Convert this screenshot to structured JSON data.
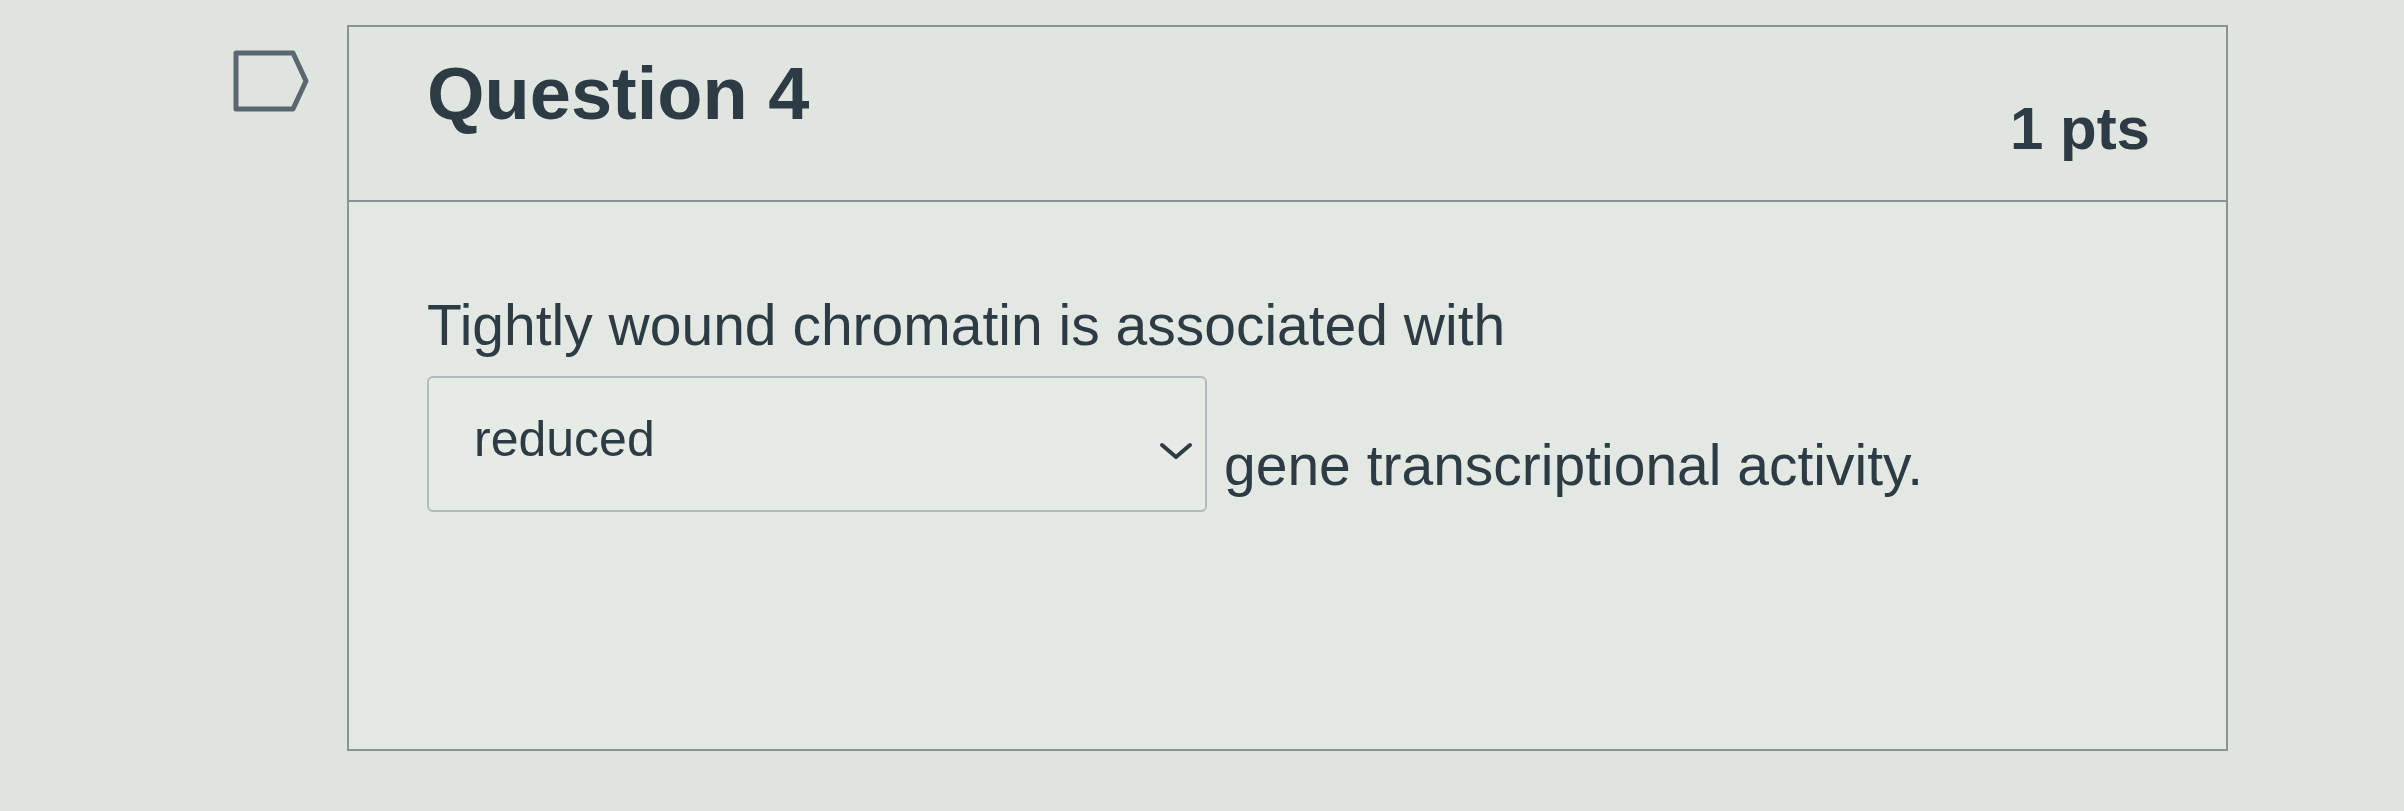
{
  "question": {
    "title": "Question 4",
    "points": "1 pts",
    "flagged": false
  },
  "prompt": "Tightly wound chromatin is associated with",
  "answer": {
    "value": "reduced"
  },
  "suffix": "gene transcriptional activity."
}
